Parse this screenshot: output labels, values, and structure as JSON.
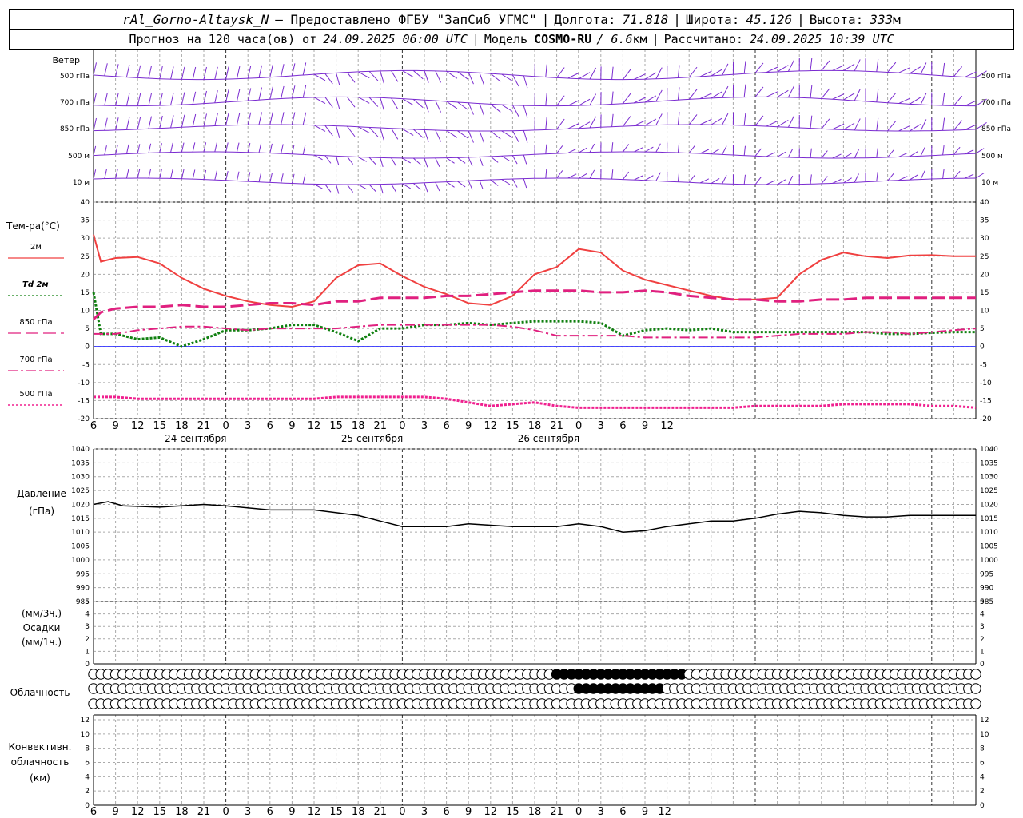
{
  "header": {
    "station": "rAl_Gorno-Altaysk_N",
    "provided_by": "– Предоставлено ФГБУ \"ЗапСиб УГМС\"",
    "lon_label": "Долгота:",
    "lon": "71.818",
    "lat_label": "Широта:",
    "lat": "45.126",
    "alt_label": "Высота:",
    "alt": "333",
    "alt_unit": "м",
    "forecast_label": "Прогноз на 120 часа(ов) от",
    "forecast_start": "24.09.2025 06:00 UTC",
    "model_label": "Модель",
    "model": "COSMO-RU",
    "resolution": "/ 6.6",
    "res_unit": "км",
    "computed_label": "Рассчитано:",
    "computed": "24.09.2025 10:39 UTC"
  },
  "colors": {
    "t2m": "#f04040",
    "td2m": "#108010",
    "t850": "#e0207f",
    "t700": "#e0207f",
    "t500": "#f0208f",
    "pressure": "#000000",
    "wind": "#7a2bd0",
    "zero_line": "#3333ff",
    "grid": "#999999"
  },
  "chart_data": [
    {
      "type": "wind_barbs",
      "label": "Ветер",
      "levels": [
        "500 гПа",
        "700 гПа",
        "850 гПа",
        "500 м",
        "10 м"
      ]
    },
    {
      "type": "line",
      "ylabel": "Тем-ра(°С)",
      "ylim": [
        -20,
        40
      ],
      "yticks": [
        -20,
        -15,
        -10,
        -5,
        0,
        5,
        10,
        15,
        20,
        25,
        30,
        35,
        40
      ],
      "x_ticks": [
        "6",
        "9",
        "12",
        "15",
        "18",
        "21",
        "0",
        "3",
        "6",
        "9",
        "12",
        "15",
        "18",
        "21",
        "0",
        "3",
        "6",
        "9",
        "12",
        "15",
        "18",
        "21",
        "0",
        "3",
        "6",
        "9",
        "12"
      ],
      "day_labels": [
        {
          "text": "24 сентября",
          "at_hour": 9
        },
        {
          "text": "25 сентября",
          "at_hour": 33
        },
        {
          "text": "26 сентября",
          "at_hour": 57
        }
      ],
      "x_hours_since_start": [
        0,
        1,
        3,
        6,
        9,
        12,
        15,
        18,
        21,
        24,
        27,
        30,
        33,
        36,
        39,
        42,
        45,
        48,
        51,
        54,
        57,
        60,
        63,
        66,
        69,
        72,
        75,
        78,
        81,
        84,
        87,
        90,
        93,
        96,
        99,
        102,
        105,
        108,
        111,
        114,
        117,
        120
      ],
      "series": [
        {
          "name": "2м",
          "style": "solid",
          "values": [
            31,
            23.5,
            24.5,
            24.8,
            23,
            19,
            16,
            14,
            12.5,
            11.5,
            11,
            12.5,
            19,
            22.5,
            23,
            19.5,
            16.5,
            14.5,
            12,
            11.5,
            14,
            20,
            22,
            27,
            26,
            21,
            18.5,
            17,
            15.5,
            14,
            13,
            13,
            13.5,
            20,
            24,
            26,
            25,
            24.5,
            25.2,
            25.3,
            25,
            25
          ]
        },
        {
          "name": "Td 2м",
          "style": "dotted",
          "values": [
            15,
            3.5,
            3.5,
            2,
            2.5,
            0,
            2,
            4.5,
            4.5,
            5,
            6,
            6,
            4,
            1.5,
            5,
            5,
            6,
            6,
            6.5,
            6,
            6.5,
            7,
            7,
            7,
            6.5,
            3,
            4.5,
            5,
            4.5,
            5,
            4,
            4,
            4,
            4,
            4,
            4,
            4,
            3.5,
            3.5,
            3.8,
            4,
            4
          ]
        },
        {
          "name": "850 гПа",
          "style": "long-dash",
          "values": [
            7.5,
            9.5,
            10.5,
            11,
            11,
            11.5,
            11,
            11,
            11.5,
            12,
            12,
            11.5,
            12.5,
            12.5,
            13.5,
            13.5,
            13.5,
            14,
            14,
            14.5,
            15,
            15.5,
            15.5,
            15.5,
            15,
            15,
            15.5,
            15,
            14,
            13.5,
            13,
            13,
            12.5,
            12.5,
            13,
            13,
            13.5,
            13.5,
            13.5,
            13.5,
            13.5,
            13.5
          ]
        },
        {
          "name": "700 гПа",
          "style": "dash-dot",
          "values": [
            3.5,
            3.5,
            3.5,
            4.5,
            5,
            5.5,
            5.5,
            5,
            4.5,
            5,
            5,
            5,
            5,
            5.5,
            6,
            6,
            6,
            6,
            6,
            6,
            5.5,
            4.5,
            3,
            3,
            3,
            3,
            2.5,
            2.5,
            2.5,
            2.5,
            2.5,
            2.5,
            3,
            3.5,
            3.5,
            3.5,
            4,
            4,
            3.5,
            4,
            4.5,
            5
          ]
        },
        {
          "name": "500 гПа",
          "style": "dotted",
          "values": [
            -14,
            -14,
            -14,
            -14.5,
            -14.5,
            -14.5,
            -14.5,
            -14.5,
            -14.5,
            -14.5,
            -14.5,
            -14.5,
            -14,
            -14,
            -14,
            -14,
            -14,
            -14.5,
            -15.5,
            -16.5,
            -16,
            -15.5,
            -16.5,
            -17,
            -17,
            -17,
            -17,
            -17,
            -17,
            -17,
            -17,
            -16.5,
            -16.5,
            -16.5,
            -16.5,
            -16,
            -16,
            -16,
            -16,
            -16.5,
            -16.5,
            -17
          ]
        }
      ]
    },
    {
      "type": "line",
      "ylabel": "Давление",
      "yunit": "(гПа)",
      "ylim": [
        985,
        1040
      ],
      "yticks": [
        985,
        990,
        995,
        1000,
        1005,
        1010,
        1015,
        1020,
        1025,
        1030,
        1035,
        1040
      ],
      "x_hours_since_start": [
        0,
        2,
        4,
        9,
        15,
        18,
        24,
        27,
        30,
        36,
        39,
        42,
        48,
        51,
        54,
        57,
        60,
        63,
        66,
        69,
        72,
        75,
        78,
        81,
        84,
        87,
        90,
        93,
        96,
        99,
        102,
        105,
        108,
        111,
        114,
        117,
        120
      ],
      "series": [
        {
          "name": "Давление",
          "style": "solid",
          "values": [
            1020,
            1021,
            1019.5,
            1019,
            1020,
            1019.5,
            1018,
            1018,
            1018,
            1016,
            1014,
            1012,
            1012,
            1013,
            1012.5,
            1012,
            1012,
            1012,
            1013,
            1012,
            1010,
            1010.5,
            1012,
            1013,
            1014,
            1014,
            1015,
            1016.5,
            1017.5,
            1017,
            1016,
            1015.5,
            1015.5,
            1016,
            1016,
            1016,
            1016
          ]
        }
      ]
    },
    {
      "type": "bar",
      "ylabel": "Осадки",
      "yunit_top": "(мм/3ч.)",
      "yunit_bottom": "(мм/1ч.)",
      "ylim": [
        0,
        5
      ],
      "yticks": [
        0,
        1,
        2,
        3,
        4,
        5
      ],
      "values": []
    },
    {
      "type": "cloud_cover",
      "ylabel": "Облачность",
      "rows": 3,
      "columns": 121,
      "note": "row 1 overcast roughly hours 63-80, row 2 roughly hours 66-77"
    },
    {
      "type": "bar",
      "ylabel": "Конвективн.",
      "ylabel2": "облачность",
      "yunit": "(км)",
      "ylim": [
        0,
        12
      ],
      "yticks": [
        0,
        2,
        4,
        6,
        8,
        10,
        12
      ],
      "values": []
    }
  ]
}
